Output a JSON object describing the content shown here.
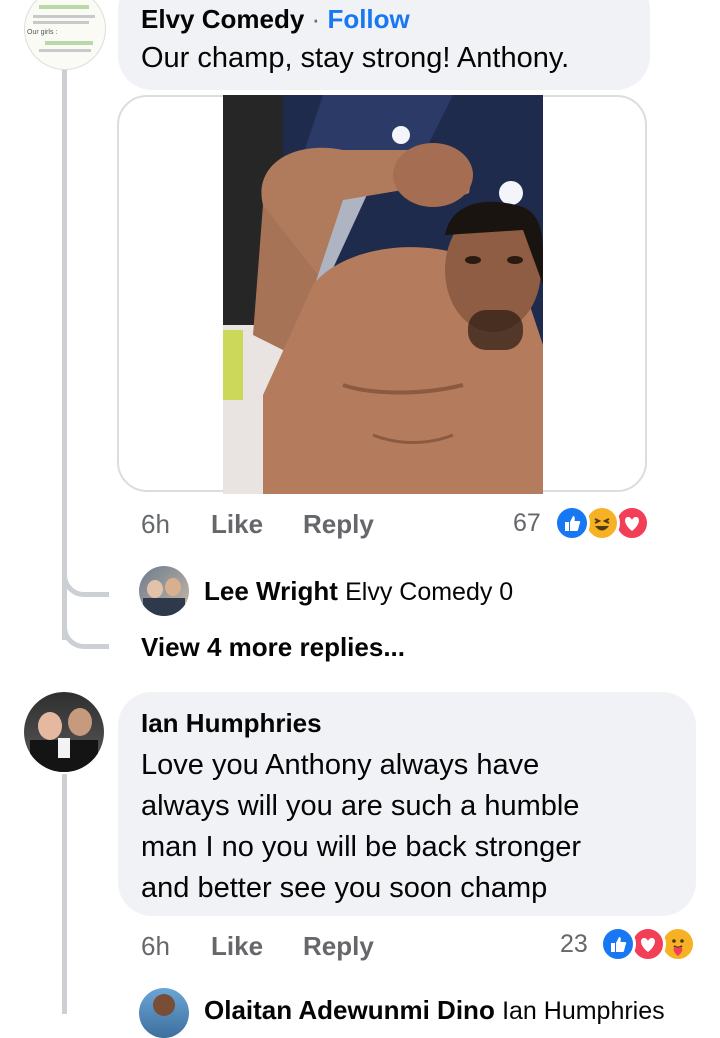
{
  "comment1": {
    "author": "Elvy Comedy",
    "separator": "·",
    "follow": "Follow",
    "text": "Our champ, stay strong! Anthony.",
    "time": "6h",
    "like": "Like",
    "reply": "Reply",
    "reaction_count": "67",
    "reactions": [
      "like-icon",
      "haha-icon",
      "love-icon"
    ],
    "avatar_snippet": "Our girls :"
  },
  "reply1": {
    "author": "Lee Wright",
    "text": "Elvy Comedy 0"
  },
  "view_more": "View 4 more replies...",
  "comment2": {
    "author": "Ian Humphries",
    "text_lines": [
      "Love you Anthony always have",
      "always will you are such a humble",
      "man I no you will be back stronger",
      "and better see you soon champ"
    ],
    "time": "6h",
    "like": "Like",
    "reply": "Reply",
    "reaction_count": "23",
    "reactions": [
      "like-icon",
      "love-icon",
      "care-icon"
    ]
  },
  "reply2": {
    "author": "Olaitan Adewunmi Dino",
    "text": "Ian Humphries"
  },
  "colors": {
    "accent": "#1877f2",
    "bubble": "#f0f2f5",
    "muted": "#65676b",
    "love": "#f33e58",
    "haha": "#f7b125"
  }
}
